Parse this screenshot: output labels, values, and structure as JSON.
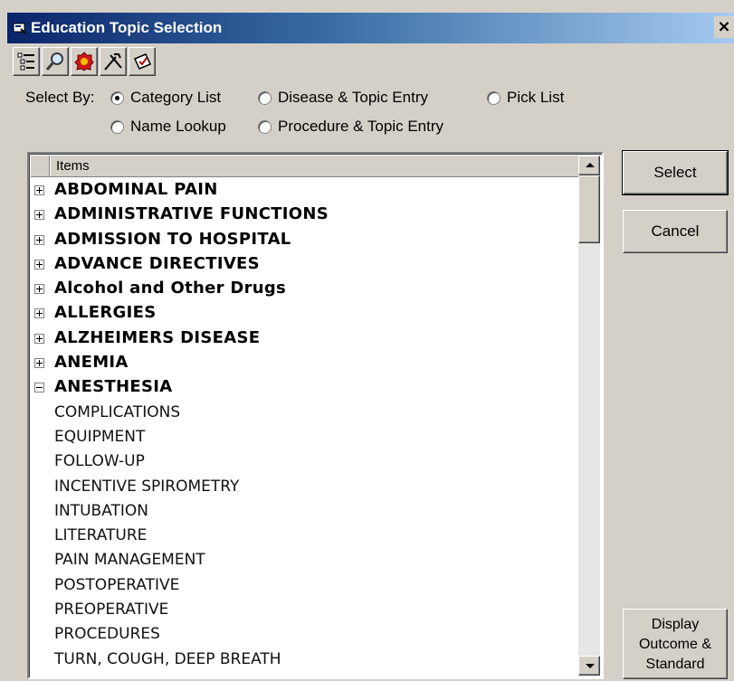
{
  "window": {
    "title": "Education Topic Selection",
    "close_glyph": "×"
  },
  "toolbar": {
    "buttons": [
      {
        "icon": "tree-list-icon"
      },
      {
        "icon": "magnifier-icon"
      },
      {
        "icon": "red-badge-icon"
      },
      {
        "icon": "tools-icon"
      },
      {
        "icon": "document-check-icon"
      }
    ]
  },
  "select_by": {
    "label": "Select By:",
    "options": [
      {
        "label": "Category List",
        "checked": true
      },
      {
        "label": "Disease & Topic Entry",
        "checked": false
      },
      {
        "label": "Pick List",
        "checked": false
      },
      {
        "label": "Name Lookup",
        "checked": false
      },
      {
        "label": "Procedure & Topic Entry",
        "checked": false
      }
    ]
  },
  "list": {
    "header": "Items",
    "categories": [
      {
        "label": "ABDOMINAL PAIN",
        "expanded": false
      },
      {
        "label": "ADMINISTRATIVE FUNCTIONS",
        "expanded": false
      },
      {
        "label": "ADMISSION TO HOSPITAL",
        "expanded": false
      },
      {
        "label": "ADVANCE DIRECTIVES",
        "expanded": false
      },
      {
        "label": "Alcohol and Other Drugs",
        "expanded": false
      },
      {
        "label": "ALLERGIES",
        "expanded": false
      },
      {
        "label": "ALZHEIMERS DISEASE",
        "expanded": false
      },
      {
        "label": "ANEMIA",
        "expanded": false
      },
      {
        "label": "ANESTHESIA",
        "expanded": true
      }
    ],
    "subitems": [
      "COMPLICATIONS",
      "EQUIPMENT",
      "FOLLOW-UP",
      "INCENTIVE SPIROMETRY",
      "INTUBATION",
      "LITERATURE",
      "PAIN MANAGEMENT",
      "POSTOPERATIVE",
      "PREOPERATIVE",
      "PROCEDURES",
      "TURN, COUGH, DEEP BREATH"
    ]
  },
  "buttons": {
    "select": "Select",
    "cancel": "Cancel",
    "display_line1": "Display",
    "display_line2": "Outcome &",
    "display_line3": "Standard"
  },
  "colors": {
    "title_bar_start": "#0a246a",
    "title_bar_end": "#a6caf0",
    "window_face": "#d4d0c8"
  }
}
